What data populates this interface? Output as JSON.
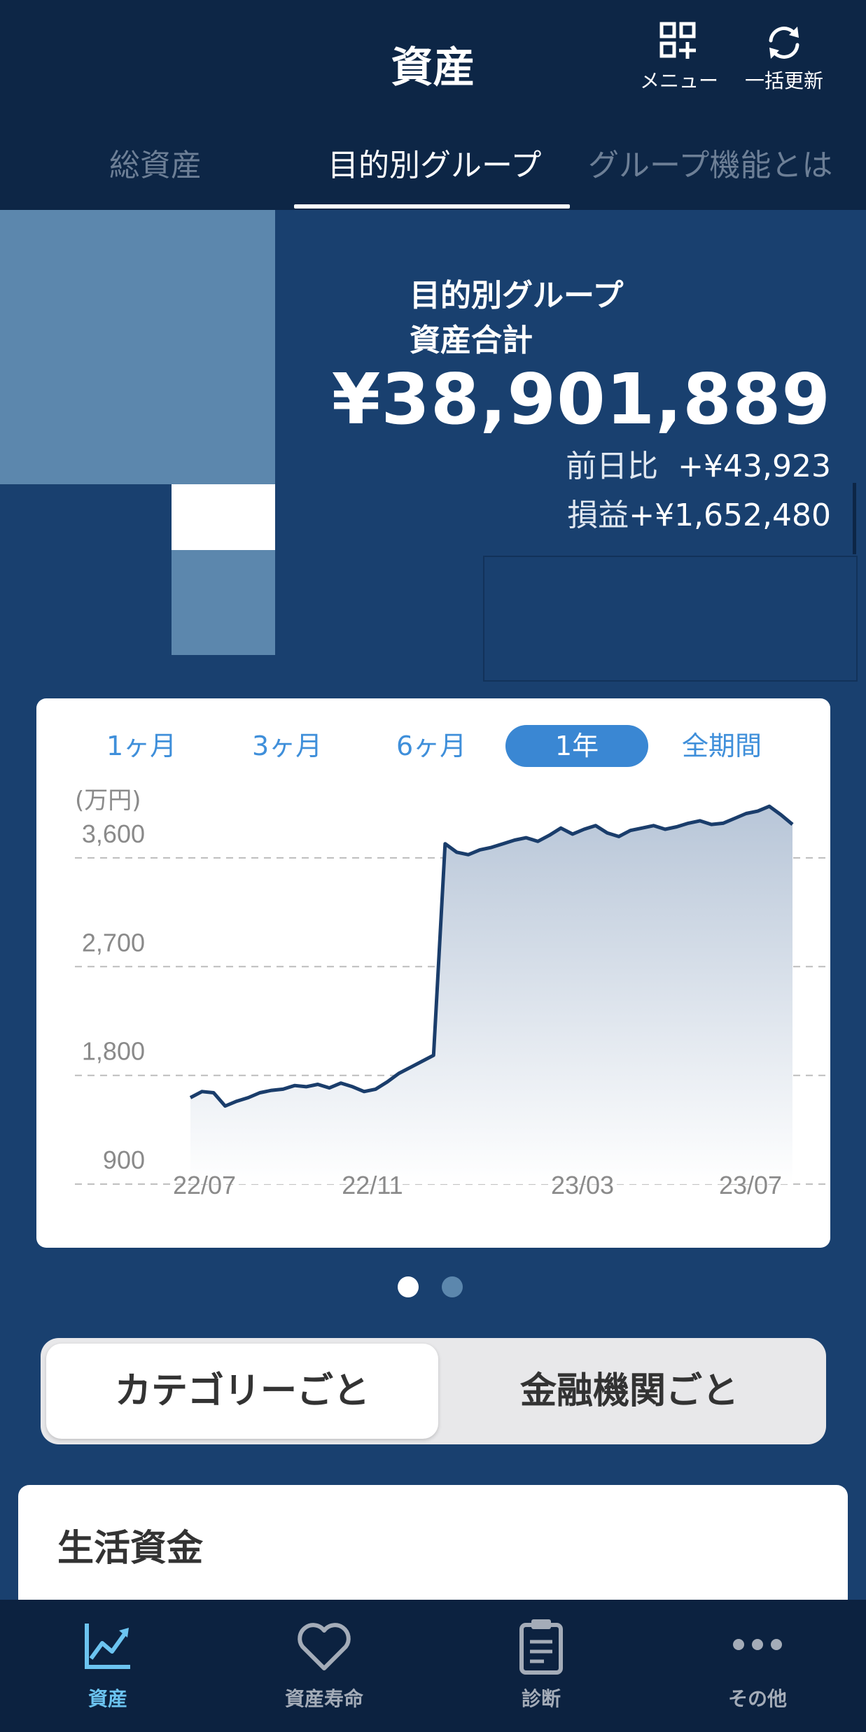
{
  "header": {
    "title": "資産",
    "actions": [
      {
        "label": "メニュー",
        "icon": "grid-plus-icon"
      },
      {
        "label": "一括更新",
        "icon": "refresh-icon"
      }
    ]
  },
  "tabs": [
    {
      "label": "総資産",
      "active": false
    },
    {
      "label": "目的別グループ",
      "active": true
    },
    {
      "label": "グループ機能とは",
      "active": false
    }
  ],
  "summary": {
    "label_line1": "目的別グループ",
    "label_line2": "資産合計",
    "total": "¥38,901,889",
    "day_change_label": "前日比",
    "day_change_value": "+¥43,923",
    "pl_label": "損益",
    "pl_value": "+¥1,652,480"
  },
  "chart": {
    "ranges": [
      "1ヶ月",
      "3ヶ月",
      "6ヶ月",
      "1年",
      "全期間"
    ],
    "selected_range": "1年",
    "unit": "(万円)"
  },
  "chart_data": {
    "type": "area",
    "ylabel": "(万円)",
    "ylim": [
      600,
      3900
    ],
    "yticks": [
      900,
      1800,
      2700,
      3600
    ],
    "ytick_labels": [
      "900",
      "1,800",
      "2,700",
      "3,600"
    ],
    "xtick_labels": [
      "22/07",
      "22/11",
      "23/03",
      "23/07"
    ],
    "grid": true,
    "series": [
      {
        "values": [
          1350,
          1400,
          1390,
          1280,
          1320,
          1350,
          1390,
          1410,
          1420,
          1450,
          1440,
          1460,
          1430,
          1470,
          1440,
          1400,
          1420,
          1480,
          1550,
          1600,
          1650,
          1700,
          3450,
          3380,
          3360,
          3400,
          3420,
          3450,
          3480,
          3500,
          3470,
          3520,
          3580,
          3530,
          3570,
          3600,
          3540,
          3510,
          3560,
          3580,
          3600,
          3570,
          3590,
          3620,
          3640,
          3610,
          3620,
          3660,
          3700,
          3720,
          3760,
          3690,
          3610
        ]
      }
    ],
    "color": "#1a3d6b"
  },
  "pager": {
    "count": 2,
    "active": 0
  },
  "segment": {
    "options": [
      "カテゴリーごと",
      "金融機関ごと"
    ],
    "selected": 0
  },
  "group": {
    "title": "生活資金"
  },
  "bottom_nav": [
    {
      "label": "資産",
      "icon": "chart-line-icon",
      "active": true
    },
    {
      "label": "資産寿命",
      "icon": "heart-icon",
      "active": false
    },
    {
      "label": "診断",
      "icon": "clipboard-icon",
      "active": false
    },
    {
      "label": "その他",
      "icon": "more-icon",
      "active": false
    }
  ],
  "colors": {
    "header_bg": "#0d2646",
    "body_bg": "#19406f",
    "accent": "#3a87d3",
    "active_nav": "#6cc4f0"
  }
}
